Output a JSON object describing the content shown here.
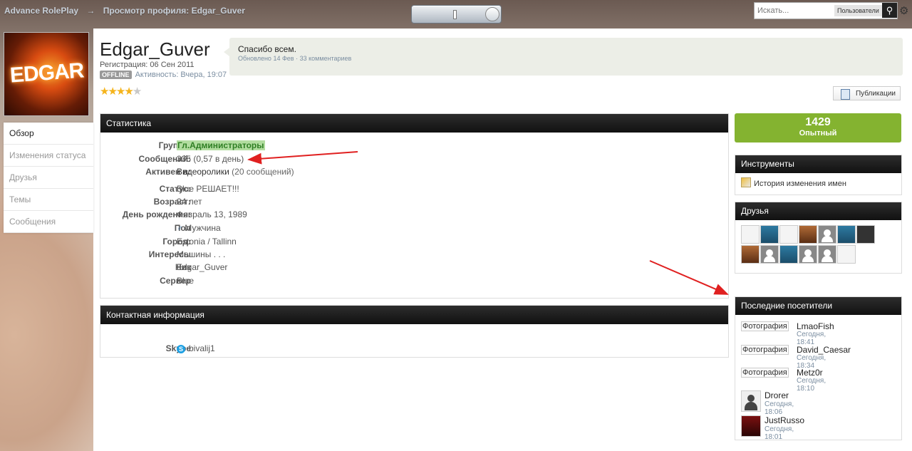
{
  "breadcrumb": {
    "home": "Advance RolePlay",
    "sep": "→",
    "current": "Просмотр профиля: Edgar_Guver"
  },
  "search": {
    "placeholder": "Искать...",
    "scope": "Пользователи",
    "go_icon": "search-icon",
    "settings_icon": "gear-icon"
  },
  "profile": {
    "name": "Edgar_Guver",
    "avatar_text": "EDGAR",
    "registration": "Регистрация: 06 Сен 2011",
    "status_badge": "OFFLINE",
    "activity": "Активность: Вчера, 19:07",
    "rating_stars": 4,
    "rating_max": 5
  },
  "status_update": {
    "text": "Спасибо всем.",
    "meta": "Обновлено 14 Фев · 33 комментариев"
  },
  "publications_button": "Публикации",
  "nav": {
    "items": [
      "Обзор",
      "Изменения статуса",
      "Друзья",
      "Темы",
      "Сообщения"
    ],
    "active": 0
  },
  "stats": {
    "title": "Статистика",
    "rows": [
      {
        "label": "Группа:",
        "value": "Гл.Администраторы"
      },
      {
        "label": "Сообщений:",
        "value": "335 (0,57 в день)"
      },
      {
        "label": "Активен в:",
        "value": "Видеоролики",
        "extra": "(20 сообщений)"
      },
      {
        "label": "Статус:",
        "value": "Blue РЕШАЕТ!!!"
      },
      {
        "label": "Возраст:",
        "value": "24 лет"
      },
      {
        "label": "День рождения:",
        "value": "Февраль 13, 1989"
      },
      {
        "label": "Пол",
        "value": "Мужчина"
      },
      {
        "label": "Город:",
        "value": "Estonia / Tallinn"
      },
      {
        "label": "Интересы",
        "value": "Машины . . ."
      },
      {
        "label": "Ник",
        "value": "Edgar_Guver"
      },
      {
        "label": "Сервер",
        "value": "Blue"
      }
    ]
  },
  "contact": {
    "title": "Контактная информация",
    "label": "Skype",
    "value": "bivalij1"
  },
  "reputation": {
    "value": "1429",
    "label": "Опытный",
    "color": "#84b330"
  },
  "tools": {
    "title": "Инструменты",
    "item": "История изменения имен"
  },
  "friends": {
    "title": "Друзья",
    "count": 13
  },
  "visitors": {
    "title": "Последние посетители",
    "list": [
      {
        "alt": "Фотография",
        "name": "LmaoFish",
        "time": "Сегодня, 18:41"
      },
      {
        "alt": "Фотография",
        "name": "David_Caesar",
        "time": "Сегодня, 18:34"
      },
      {
        "alt": "Фотография",
        "name": "Metz0r",
        "time": "Сегодня, 18:10"
      },
      {
        "alt": "",
        "name": "Drorer",
        "time": "Сегодня, 18:06"
      },
      {
        "alt": "",
        "name": "JustRusso",
        "time": "Сегодня, 18:01"
      }
    ]
  }
}
